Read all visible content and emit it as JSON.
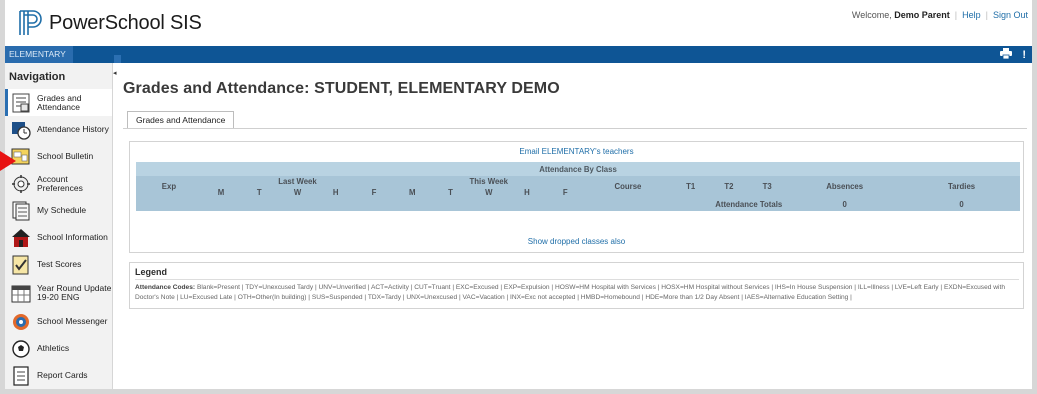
{
  "header": {
    "brand": "PowerSchool SIS",
    "welcome_prefix": "Welcome,",
    "user_name": "Demo Parent",
    "help": "Help",
    "sign_out": "Sign Out"
  },
  "topbar": {
    "school": "ELEMENTARY",
    "print_icon": "printer-icon",
    "alert_icon": "exclamation-icon"
  },
  "sidebar": {
    "title": "Navigation",
    "items": [
      {
        "label": "Grades and Attendance",
        "icon": "grades-icon",
        "active": true
      },
      {
        "label": "Attendance History",
        "icon": "attendance-history-icon"
      },
      {
        "label": "School Bulletin",
        "icon": "bulletin-icon"
      },
      {
        "label": "Account Preferences",
        "icon": "preferences-icon"
      },
      {
        "label": "My Schedule",
        "icon": "schedule-icon"
      },
      {
        "label": "School Information",
        "icon": "school-info-icon"
      },
      {
        "label": "Test Scores",
        "icon": "test-scores-icon"
      },
      {
        "label": "Year Round Update 19-20 ENG",
        "icon": "calendar-icon"
      },
      {
        "label": "School Messenger",
        "icon": "messenger-icon"
      },
      {
        "label": "Athletics",
        "icon": "ball-icon"
      },
      {
        "label": "Report Cards",
        "icon": "report-card-icon"
      }
    ]
  },
  "main": {
    "title": "Grades and Attendance: STUDENT, ELEMENTARY DEMO",
    "tab": "Grades and Attendance",
    "email_link": "Email ELEMENTARY's teachers",
    "table": {
      "caption": "Attendance By Class",
      "exp": "Exp",
      "last_week": "Last Week",
      "this_week": "This Week",
      "days": [
        "M",
        "T",
        "W",
        "H",
        "F"
      ],
      "course": "Course",
      "terms": [
        "T1",
        "T2",
        "T3"
      ],
      "absences": "Absences",
      "tardies": "Tardies",
      "totals_label": "Attendance Totals",
      "absences_total": "0",
      "tardies_total": "0"
    },
    "dropped_link": "Show dropped classes also"
  },
  "legend": {
    "title": "Legend",
    "codes_label": "Attendance Codes:",
    "codes": "Blank=Present | TDY=Unexcused Tardy | UNV=Unverified | ACT=Activity | CUT=Truant | EXC=Excused | EXP=Expulsion | HOSW=HM Hospital with Services | HOSX=HM Hospital without Services | IHS=In House Suspension | ILL=Illness | LVE=Left Early | EXDN=Excused with Doctor's Note | LU=Excused Late | OTH=Other(In building) | SUS=Suspended | TDX=Tardy | UNX=Unexcused | VAC=Vacation | INX=Exc not accepted | HMBD=Homebound | HDE=More than 1/2 Day Absent | IAES=Alternative Education Setting |"
  },
  "colors": {
    "topbar": "#0e5595",
    "table_header": "#a8c5d7",
    "link": "#1f6ea8",
    "annotation_arrow": "#e81212"
  }
}
